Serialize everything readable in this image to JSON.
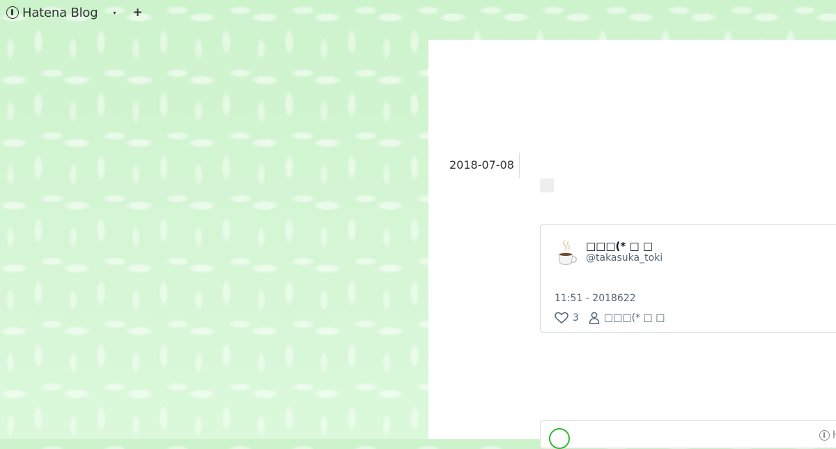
{
  "header": {
    "logo_text": "Hatena Blog",
    "menu_caret": "▾",
    "add_label": "+"
  },
  "entry": {
    "date": "2018-07-08"
  },
  "tweet": {
    "name": "□□□(* □ □",
    "handle": "@takasuka_toki",
    "time": "11:51 - 2018622",
    "like_count": "3",
    "author_label": "□□□(* □ □"
  },
  "bottom_card": {
    "logo_text": "Ha"
  },
  "colors": {
    "background": "#d6f5d6",
    "panel": "#ffffff",
    "text": "#333333",
    "muted": "#536471",
    "accent_green": "#2db82d"
  },
  "icons": [
    "hatena-logo-icon",
    "chevron-down-icon",
    "plus-icon",
    "coffee-cup-icon",
    "heart-icon",
    "person-icon"
  ]
}
